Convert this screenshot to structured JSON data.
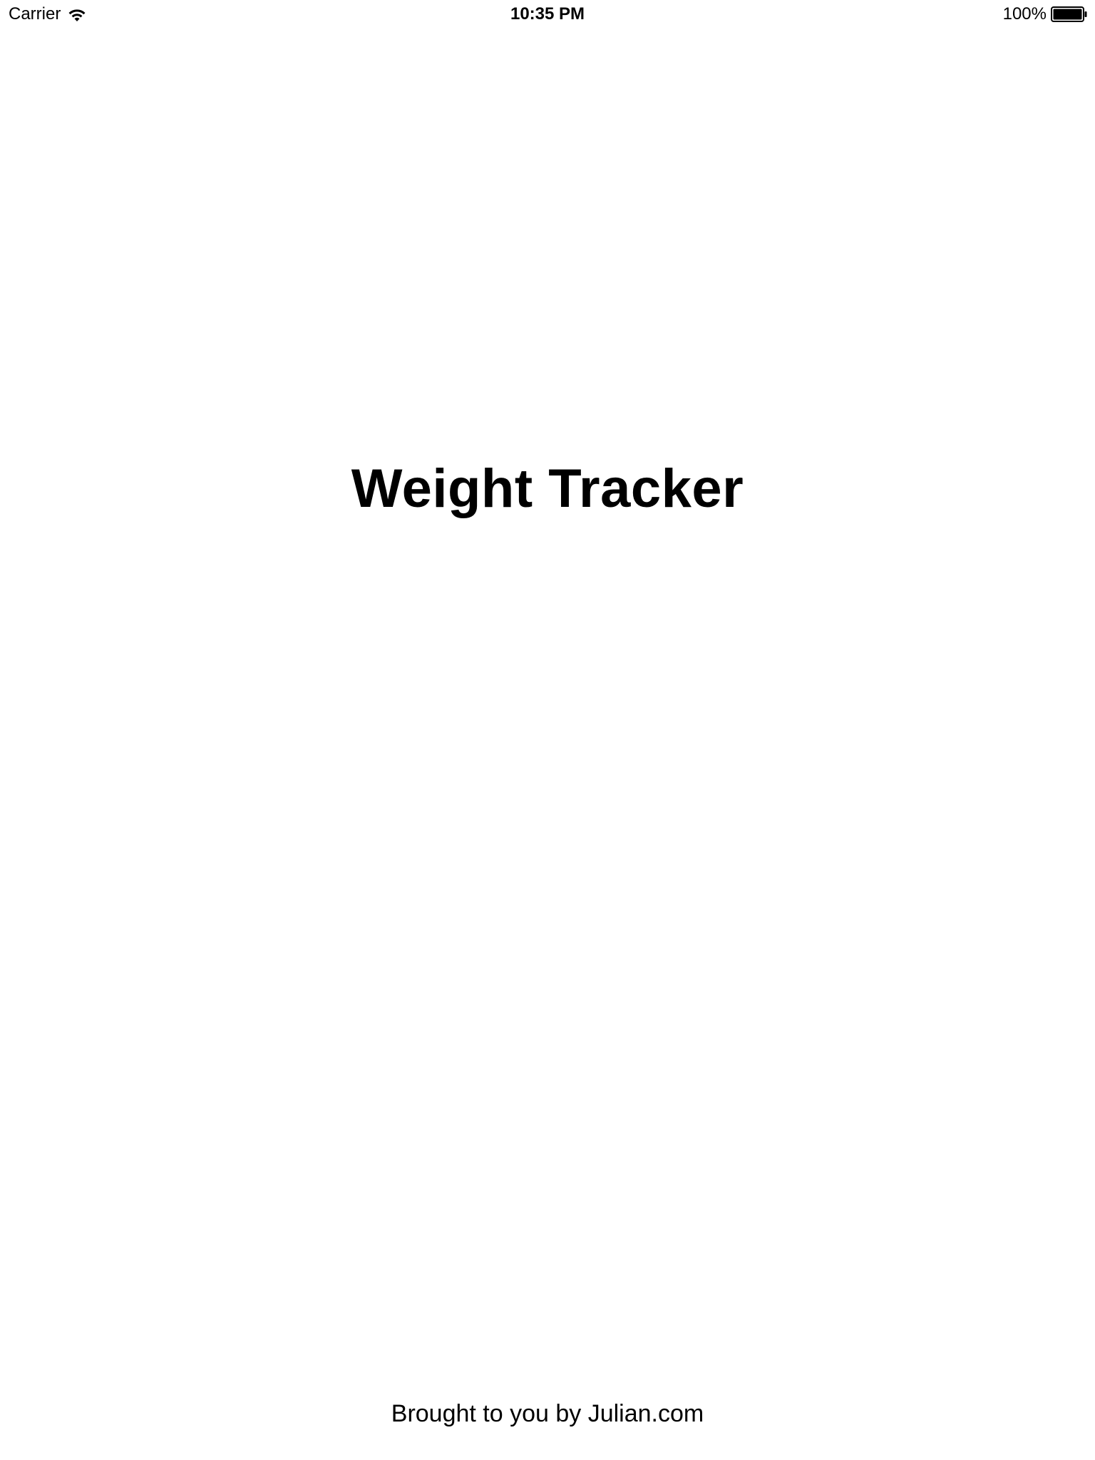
{
  "status_bar": {
    "carrier": "Carrier",
    "time": "10:35 PM",
    "battery_percent": "100%",
    "battery_level": 1.0,
    "icons": [
      "wifi-icon",
      "battery-icon"
    ]
  },
  "main": {
    "title": "Weight Tracker"
  },
  "footer": {
    "credit": "Brought to you by Julian.com"
  },
  "colors": {
    "background": "#ffffff",
    "text": "#000000"
  }
}
